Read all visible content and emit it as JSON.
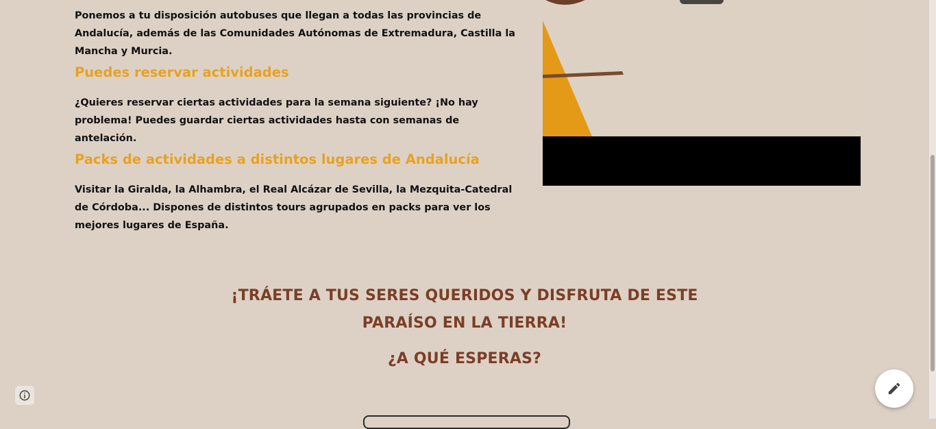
{
  "content": {
    "paragraph_autobuses": "Ponemos a tu disposición autobuses que llegan a todas las provincias de Andalucía, además de las Comunidades Autónomas de Extremadura, Castilla la Mancha y Murcia.",
    "heading_reservar": "Puedes reservar actividades",
    "paragraph_reservar": "¿Quieres reservar ciertas actividades para la semana siguiente? ¡No hay problema! Puedes guardar ciertas actividades hasta con semanas de antelación.",
    "heading_packs": "Packs de actividades a distintos lugares de Andalucía",
    "paragraph_packs": "Visitar la Giralda, la Alhambra, el Real Alcázar de Sevilla, la Mezquita-Catedral de Córdoba... Dispones de distintos tours agrupados en packs para ver los mejores lugares de España."
  },
  "cta": {
    "line1": "¡TRÁETE A TUS SERES QUERIDOS Y DISFRUTA DE ESTE PARAÍSO EN LA TIERRA!",
    "line2": "¿A QUÉ ESPERAS?"
  },
  "icons": {
    "info": "info-icon",
    "edit": "pencil-icon"
  },
  "colors": {
    "background": "#ddd1c5",
    "heading_accent": "#e8a121",
    "cta_text": "#7b3e27",
    "body_text": "#111111"
  }
}
